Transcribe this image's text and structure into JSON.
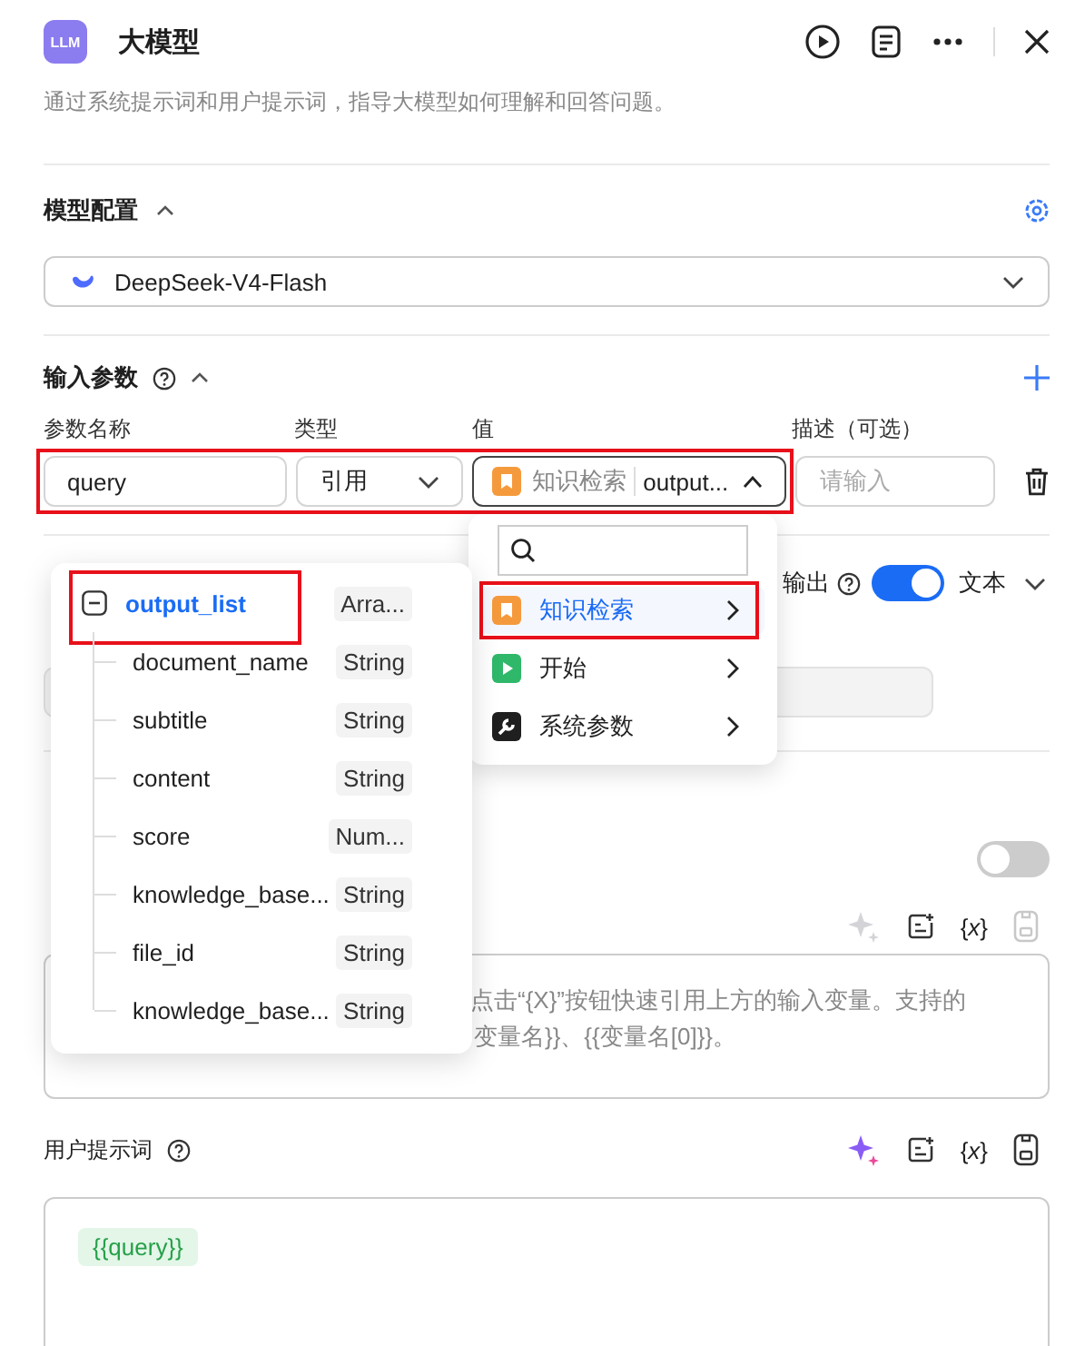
{
  "header": {
    "icon_text": "LLM",
    "title": "大模型",
    "description": "通过系统提示词和用户提示词，指导大模型如何理解和回答问题。"
  },
  "model_config": {
    "title": "模型配置",
    "expanded": true,
    "model": "DeepSeek-V4-Flash"
  },
  "input_params": {
    "title": "输入参数",
    "expanded": true,
    "columns": [
      "参数名称",
      "类型",
      "值",
      "描述（可选）"
    ],
    "rows": [
      {
        "name": "query",
        "type": "引用",
        "source": "知识检索",
        "value": "output...",
        "open": true,
        "description_placeholder": "请输入",
        "highlighted": true
      }
    ]
  },
  "output": {
    "label": "输出",
    "on": true,
    "format": "文本"
  },
  "knowledge_switch": {
    "on": false
  },
  "system_prompt": {
    "variable_button": "{*x*}",
    "placeholder_lines": [
      "点击“{X}”按钮快速引用上方的输入变量。支持的",
      "变量名}}、{{变量名[0]}}。"
    ]
  },
  "user_prompt": {
    "title": "用户提示词",
    "variable_button": "{*x*}",
    "chips": [
      "{{query}}"
    ]
  },
  "variable_tree": {
    "items": [
      {
        "name": "output_list",
        "type": "Arra...",
        "selected": true,
        "highlighted": true,
        "expanded": true,
        "children": [
          {
            "name": "document_name",
            "type": "String"
          },
          {
            "name": "subtitle",
            "type": "String"
          },
          {
            "name": "content",
            "type": "String"
          },
          {
            "name": "score",
            "type": "Num..."
          },
          {
            "name": "knowledge_base...",
            "type": "String"
          },
          {
            "name": "file_id",
            "type": "String"
          },
          {
            "name": "knowledge_base...",
            "type": "String"
          }
        ]
      }
    ]
  },
  "source_menu": {
    "items": [
      {
        "label": "知识检索",
        "kind": "knowledge",
        "selected": true,
        "highlighted": true
      },
      {
        "label": "开始",
        "kind": "start",
        "selected": false,
        "highlighted": false
      },
      {
        "label": "系统参数",
        "kind": "system",
        "selected": false,
        "highlighted": false
      }
    ]
  }
}
